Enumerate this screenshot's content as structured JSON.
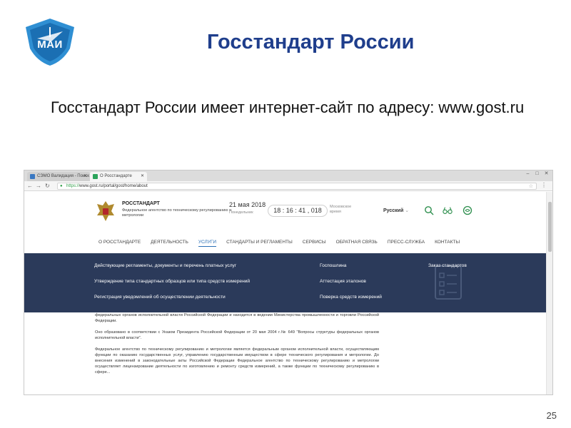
{
  "slide": {
    "title": "Госстандарт России",
    "text": "Госстандарт России имеет интернет-сайт по адресу: www.gost.ru",
    "page_number": "25",
    "logo_text": "МАИ"
  },
  "browser": {
    "tabs": [
      {
        "label": "СЭМО Валидация - Поиск"
      },
      {
        "label": "О Росстандарте"
      }
    ],
    "url_https": "https://",
    "url_rest": "www.gost.ru/portal/gost/home/about"
  },
  "site": {
    "org_name": "РОССТАНДАРТ",
    "org_sub": "Федеральное агентство по техническому регулированию и метрологии",
    "date": "21 мая 2018",
    "weekday": "Понедельник",
    "time": "18 : 16 : 41 , 018",
    "timezone": "Московское время",
    "language": "Русский",
    "nav": [
      "О РОССТАНДАРТЕ",
      "ДЕЯТЕЛЬНОСТЬ",
      "УСЛУГИ",
      "СТАНДАРТЫ И РЕГЛАМЕНТЫ",
      "СЕРВИСЫ",
      "ОБРАТНАЯ СВЯЗЬ",
      "ПРЕСС-СЛУЖБА",
      "КОНТАКТЫ"
    ],
    "active_nav": "УСЛУГИ",
    "dropdown": {
      "col1": [
        "Действующие регламенты, документы и перечень платных услуг",
        "Утверждение типа стандартных образцов или типа средств измерений",
        "Регистрация уведомлений об осуществлении деятельности"
      ],
      "col2": [
        "Госпошлина",
        "Аттестация эталонов",
        "Поверка средств измерений"
      ],
      "col3": [
        "Заказ стандартов"
      ]
    },
    "body": [
      "федеральных органов исполнительной власти Российской Федерации и находится в ведении Министерства промышленности и торговли Российской Федерации.",
      "Оно образовано в соответствии с Указом Президента Российской Федерации от 20 мая 2004 г.№ 649 \"Вопросы структуры федеральных органов исполнительной власти\".",
      "Федеральное агентство по техническому регулированию и метрологии является федеральным органом исполнительной власти, осуществляющим функции по оказанию государственных услуг, управлению государственным имуществом в сфере технического регулирования и метрологии. До внесения изменений в законодательные акты Российской Федерации Федеральное агентство по техническому регулированию и метрологии осуществляет лицензирование деятельности по изготовлению и ремонту средств измерений, а также функции по техническому регулированию в сфере..."
    ]
  }
}
